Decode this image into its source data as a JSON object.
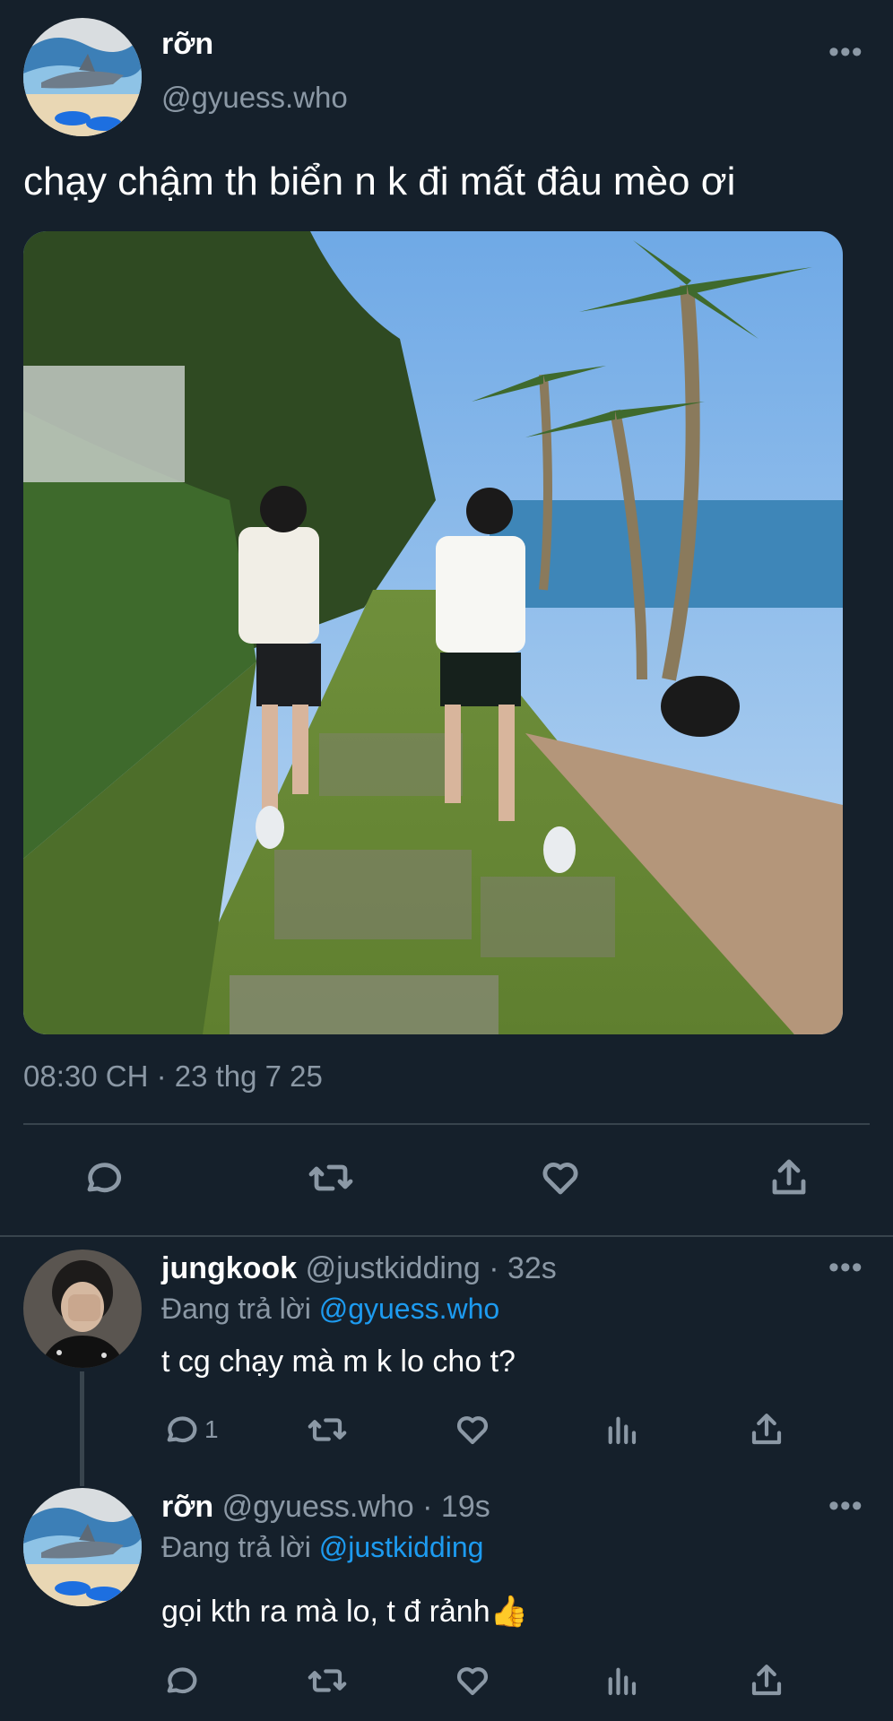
{
  "main_tweet": {
    "display_name": "rỡn",
    "handle": "@gyuess.who",
    "text": "chạy chậm th biển n k đi mất đâu mèo ơi",
    "timestamp": "08:30 CH · 23 thg 7 25",
    "actions": [
      "reply-icon",
      "retweet-icon",
      "like-icon",
      "share-icon"
    ]
  },
  "replies": [
    {
      "display_name": "jungkook",
      "handle": "@justkidding",
      "separator": "·",
      "time": "32s",
      "replying_label": "Đang trả lời",
      "replying_to": "@gyuess.who",
      "text": "t cg chạy mà m k lo cho t?",
      "reply_count": "1"
    },
    {
      "display_name": "rỡn",
      "handle": "@gyuess.who",
      "separator": "·",
      "time": "19s",
      "replying_label": "Đang trả lời",
      "replying_to": "@justkidding",
      "text": "gọi kth ra mà lo, t đ rảnh👍",
      "reply_count": ""
    }
  ],
  "colors": {
    "background": "#15202b",
    "muted_text": "#8b98a5",
    "link": "#1d9bf0",
    "divider": "#38444d"
  }
}
